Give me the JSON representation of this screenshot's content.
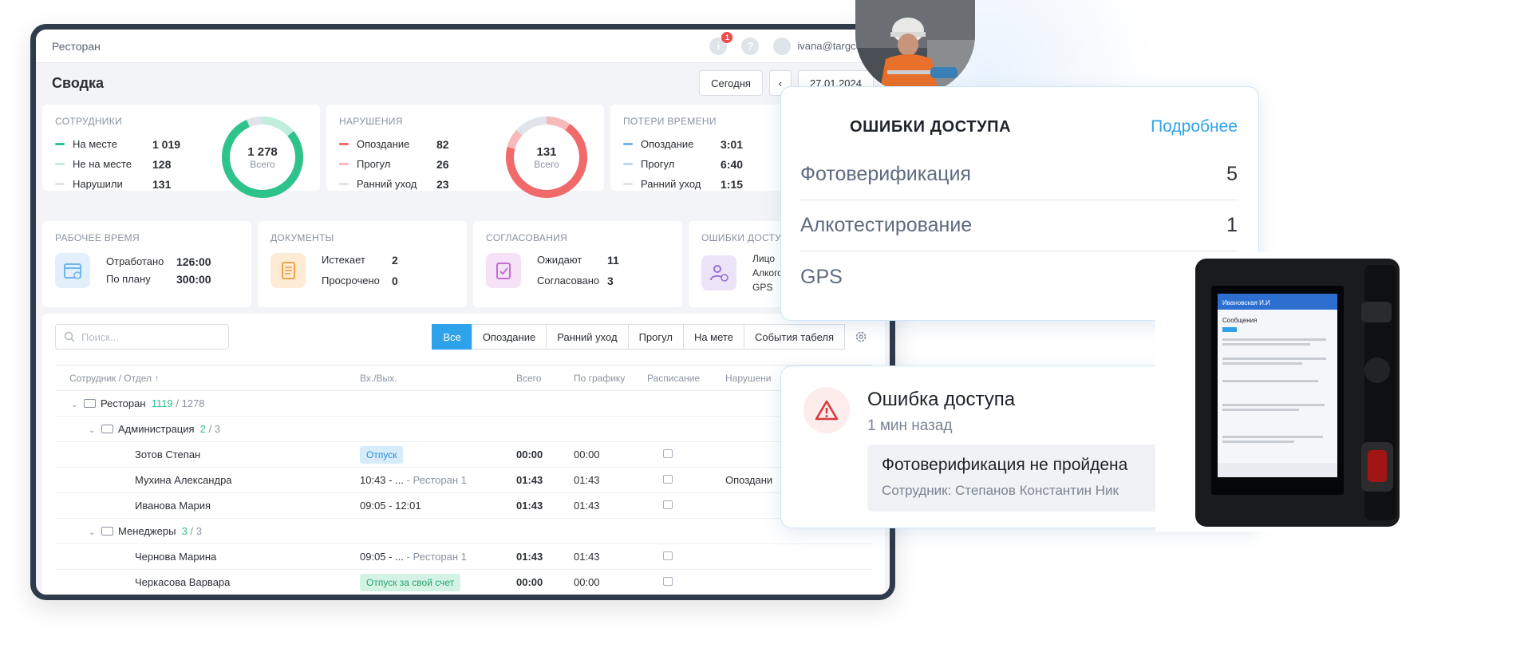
{
  "topbar": {
    "title": "Ресторан",
    "notif_count": "1",
    "user": "ivana@targcontr"
  },
  "header": {
    "title": "Сводка",
    "today": "Сегодня",
    "prev": "‹",
    "date": "27.01.2024"
  },
  "employees": {
    "title": "СОТРУДНИКИ",
    "rows": [
      {
        "label": "На месте",
        "value": "1 019",
        "color": "#2ec38a"
      },
      {
        "label": "Не на месте",
        "value": "128",
        "color": "#bfeedd"
      },
      {
        "label": "Нарушили",
        "value": "131",
        "color": "#dfe3ea"
      }
    ],
    "total": "1 278",
    "total_label": "Всего"
  },
  "violations": {
    "title": "НАРУШЕНИЯ",
    "rows": [
      {
        "label": "Опоздание",
        "value": "82",
        "color": "#f06a6a"
      },
      {
        "label": "Прогул",
        "value": "26",
        "color": "#f7b9b9"
      },
      {
        "label": "Ранний уход",
        "value": "23",
        "color": "#dfe3ea"
      }
    ],
    "total": "131",
    "total_label": "Всего"
  },
  "losses": {
    "title": "ПОТЕРИ ВРЕМЕНИ",
    "rows": [
      {
        "label": "Опоздание",
        "value": "3:01",
        "color": "#6fb6ec"
      },
      {
        "label": "Прогул",
        "value": "6:40",
        "color": "#b8daf5"
      },
      {
        "label": "Ранний уход",
        "value": "1:15",
        "color": "#dfe3ea"
      }
    ]
  },
  "worktime": {
    "title": "РАБОЧЕЕ ВРЕМЯ",
    "r1l": "Отработано",
    "r1v": "126:00",
    "r2l": "По плану",
    "r2v": "300:00"
  },
  "documents": {
    "title": "ДОКУМЕНТЫ",
    "r1l": "Истекает",
    "r1v": "2",
    "r2l": "Просрочено",
    "r2v": "0"
  },
  "approvals": {
    "title": "СОГЛАСОВАНИЯ",
    "r1l": "Ожидают",
    "r1v": "11",
    "r2l": "Согласовано",
    "r2v": "3"
  },
  "access_small": {
    "title": "ОШИБКИ ДОСТУПА",
    "r1": "Лицо",
    "r2": "Алкогол",
    "r3": "GPS"
  },
  "search": {
    "placeholder": "Поиск..."
  },
  "tabs": [
    "Все",
    "Опоздание",
    "Ранний уход",
    "Прогул",
    "На мете",
    "События табеля"
  ],
  "table": {
    "headers": [
      "Сотрудник / Отдел ↑",
      "Вх./Вых.",
      "Всего",
      "По графику",
      "Расписание",
      "Нарушени"
    ],
    "root": {
      "name": "Ресторан",
      "on": "1119",
      "total": "/ 1278"
    },
    "g1": {
      "name": "Администрация",
      "on": "2",
      "total": "/ 3"
    },
    "g2": {
      "name": "Менеджеры",
      "on": "3",
      "total": "/ 3"
    },
    "rows": [
      {
        "name": "Зотов Степан",
        "inout": "",
        "tag": "Отпуск",
        "total": "00:00",
        "plan": "00:00",
        "viol": ""
      },
      {
        "name": "Мухина Александра",
        "inout": "10:43 - ...",
        "place": "- Ресторан 1",
        "total": "01:43",
        "plan": "01:43",
        "viol": "Опоздани"
      },
      {
        "name": "Иванова Мария",
        "inout": "09:05 - 12:01",
        "total": "01:43",
        "plan": "01:43",
        "viol": ""
      },
      {
        "name": "Чернова Марина",
        "inout": "09:05 - ...",
        "place": "- Ресторан 1",
        "total": "01:43",
        "plan": "01:43",
        "viol": ""
      },
      {
        "name": "Черкасова Варвара",
        "tag": "Отпуск за свой счет",
        "total": "00:00",
        "plan": "00:00",
        "viol": ""
      }
    ]
  },
  "access_card": {
    "title": "ОШИБКИ ДОСТУПА",
    "more": "Подробнее",
    "rows": [
      {
        "label": "Фотоверификация",
        "value": "5"
      },
      {
        "label": "Алкотестирование",
        "value": "1"
      },
      {
        "label": "GPS",
        "value": ""
      }
    ]
  },
  "notification": {
    "title": "Ошибка доступа",
    "time": "1 мин назад",
    "message": "Фотоверификация не пройдена",
    "employee": "Сотрудник: Степанов Константин Ник"
  },
  "device": {
    "user": "Ивановская И.И",
    "screen_title": "Сообщения"
  }
}
